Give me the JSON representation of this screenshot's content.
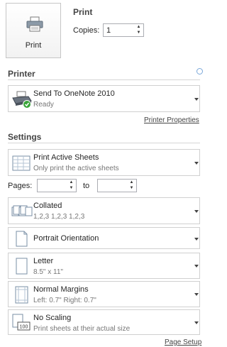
{
  "print": {
    "button_label": "Print",
    "title": "Print",
    "copies_label": "Copies:",
    "copies_value": "1"
  },
  "printer": {
    "section_title": "Printer",
    "name": "Send To OneNote 2010",
    "status": "Ready",
    "properties_link": "Printer Properties",
    "info_icon": "info-icon"
  },
  "settings": {
    "section_title": "Settings",
    "scope": {
      "title": "Print Active Sheets",
      "subtitle": "Only print the active sheets"
    },
    "pages": {
      "label": "Pages:",
      "from": "",
      "to_label": "to",
      "to": ""
    },
    "collation": {
      "title": "Collated",
      "subtitle": "1,2,3    1,2,3    1,2,3"
    },
    "orientation": {
      "title": "Portrait Orientation"
    },
    "paper": {
      "title": "Letter",
      "subtitle": "8.5\" x 11\""
    },
    "margins": {
      "title": "Normal Margins",
      "subtitle": "Left:  0.7\"    Right:  0.7\""
    },
    "scaling": {
      "title": "No Scaling",
      "subtitle": "Print sheets at their actual size",
      "icon_text": "100"
    },
    "page_setup_link": "Page Setup"
  },
  "colors": {
    "border": "#d0d0d0",
    "text": "#262626",
    "subtext": "#777777",
    "ready": "#3aa53a"
  }
}
